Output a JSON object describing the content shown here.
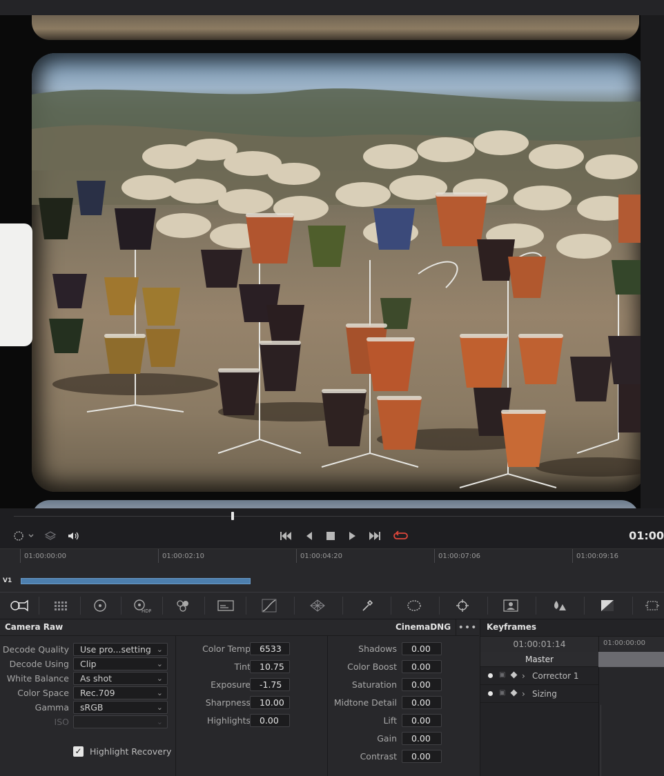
{
  "transport": {
    "timecode": "01:00",
    "viewer_options_icon": "viewer-mode-icon",
    "controls": [
      "skip-to-start",
      "step-back",
      "stop",
      "play",
      "skip-to-end",
      "loop"
    ]
  },
  "timeline": {
    "ticks": [
      "01:00:00:00",
      "01:00:02:10",
      "01:00:04:20",
      "01:00:07:06",
      "01:00:09:16"
    ],
    "track": "V1"
  },
  "camera_raw": {
    "title": "Camera Raw",
    "format": "CinemaDNG",
    "more": "•••",
    "fields": [
      {
        "label": "Decode Quality",
        "value": "Use pro...setting"
      },
      {
        "label": "Decode Using",
        "value": "Clip"
      },
      {
        "label": "White Balance",
        "value": "As shot"
      },
      {
        "label": "Color Space",
        "value": "Rec.709"
      },
      {
        "label": "Gamma",
        "value": "sRGB"
      },
      {
        "label": "ISO",
        "value": ""
      }
    ],
    "highlight_recovery": {
      "label": "Highlight Recovery",
      "checked": true
    },
    "col2": [
      {
        "label": "Color Temp",
        "value": "6533"
      },
      {
        "label": "Tint",
        "value": "10.75"
      },
      {
        "label": "Exposure",
        "value": "-1.75"
      },
      {
        "label": "Sharpness",
        "value": "10.00"
      },
      {
        "label": "Highlights",
        "value": "0.00"
      }
    ],
    "col3": [
      {
        "label": "Shadows",
        "value": "0.00"
      },
      {
        "label": "Color Boost",
        "value": "0.00"
      },
      {
        "label": "Saturation",
        "value": "0.00"
      },
      {
        "label": "Midtone Detail",
        "value": "0.00"
      },
      {
        "label": "Lift",
        "value": "0.00"
      },
      {
        "label": "Gain",
        "value": "0.00"
      },
      {
        "label": "Contrast",
        "value": "0.00"
      }
    ]
  },
  "keyframes": {
    "title": "Keyframes",
    "timecode": "01:00:01:14",
    "ruler_tc": "01:00:00:00",
    "master": "Master",
    "rows": [
      "Corrector 1",
      "Sizing"
    ]
  },
  "colors": {
    "accent_blue": "#4d7fae",
    "loop_red": "#e0473c",
    "panel_bg": "#28282b"
  }
}
